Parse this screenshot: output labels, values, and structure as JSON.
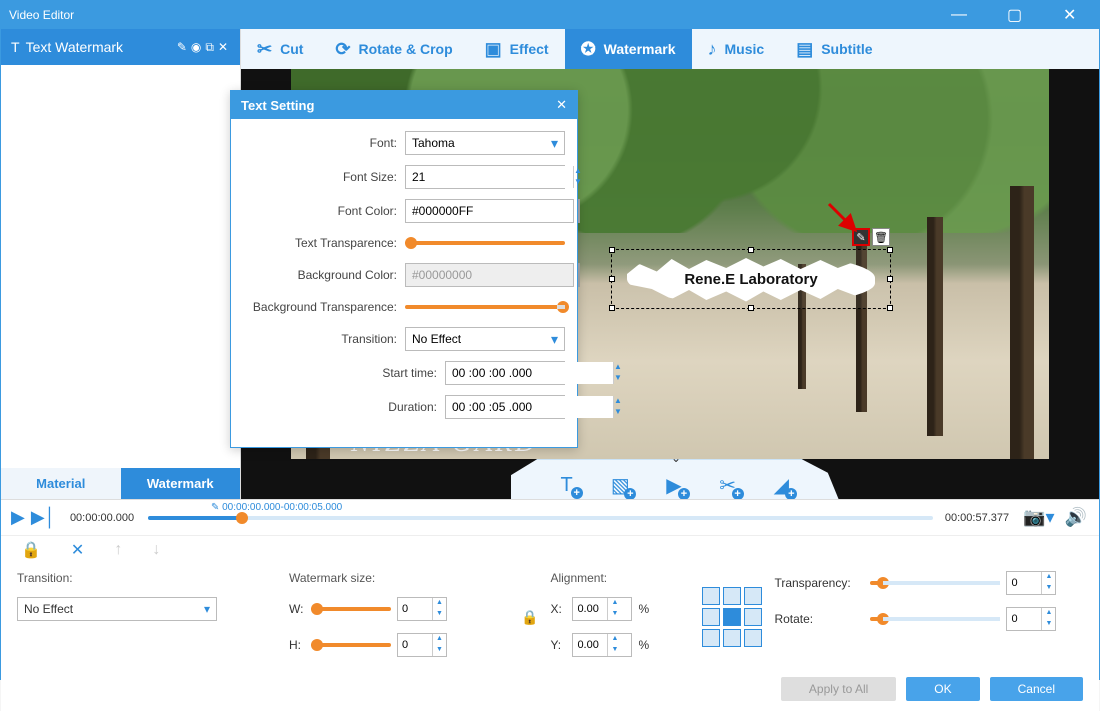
{
  "window": {
    "title": "Video Editor"
  },
  "side": {
    "header": "Text Watermark",
    "sub_tabs": [
      "Material",
      "Watermark"
    ]
  },
  "tabs": {
    "items": [
      {
        "label": "Cut"
      },
      {
        "label": "Rotate & Crop"
      },
      {
        "label": "Effect"
      },
      {
        "label": "Watermark"
      },
      {
        "label": "Music"
      },
      {
        "label": "Subtitle"
      }
    ]
  },
  "popup": {
    "title": "Text Setting",
    "labels": {
      "font": "Font:",
      "fontsize": "Font Size:",
      "fontcolor": "Font Color:",
      "text_trans": "Text Transparence:",
      "bgcolor": "Background Color:",
      "bg_trans": "Background Transparence:",
      "transition": "Transition:",
      "start": "Start time:",
      "duration": "Duration:"
    },
    "values": {
      "font": "Tahoma",
      "fontsize": "21",
      "fontcolor": "#000000FF",
      "bgcolor": "#00000000",
      "transition": "No Effect",
      "start": "00 :00 :00 .000",
      "duration": "00 :00 :05 .000"
    }
  },
  "preview": {
    "watermark_text": "Rene.E Laboratory",
    "subtitle": "NIZZA GARD"
  },
  "timeline": {
    "current": "00:00:00.000",
    "range": "00:00:00.000-00:00:05.000",
    "total": "00:00:57.377"
  },
  "bottom": {
    "transition_label": "Transition:",
    "transition_value": "No Effect",
    "wsize_label": "Watermark size:",
    "w_label": "W:",
    "h_label": "H:",
    "w_value": "0",
    "h_value": "0",
    "align_label": "Alignment:",
    "x_label": "X:",
    "y_label": "Y:",
    "x_value": "0.00",
    "y_value": "0.00",
    "pct": "%",
    "transp_label": "Transparency:",
    "transp_value": "0",
    "rotate_label": "Rotate:",
    "rotate_value": "0"
  },
  "buttons": {
    "apply": "Apply to All",
    "ok": "OK",
    "cancel": "Cancel"
  },
  "icons": {
    "minimize": "—",
    "maximize": "▢",
    "close": "✕"
  }
}
